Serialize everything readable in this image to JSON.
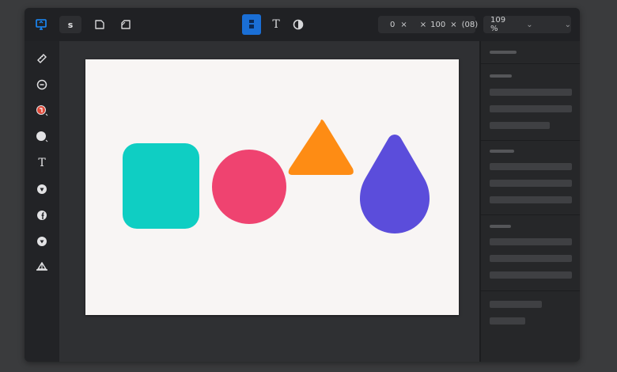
{
  "toolbar": {
    "icons": [
      "monitor-icon",
      "s-icon",
      "square-icon",
      "crop-icon",
      "document-icon",
      "text-icon",
      "fill-icon"
    ],
    "text_tool_glyph": "T",
    "s_glyph": "s",
    "position": {
      "x": "0",
      "x_sep": "×",
      "w": "100",
      "w_sep": "×",
      "extra": "(08)"
    },
    "zoom": {
      "value": "109 %",
      "chevron": "⌄"
    },
    "menu_chevron": "⌄"
  },
  "sidebar": {
    "tools": [
      {
        "name": "ruler-icon"
      },
      {
        "name": "minus-circle-icon"
      },
      {
        "name": "color-circle-icon"
      },
      {
        "name": "circle-tool-icon"
      },
      {
        "name": "text-tool-icon",
        "glyph": "T"
      },
      {
        "name": "shield-icon"
      },
      {
        "name": "facebook-icon",
        "glyph": "f"
      },
      {
        "name": "heart-shield-icon"
      },
      {
        "name": "boat-icon"
      }
    ]
  },
  "canvas": {
    "shapes": [
      {
        "name": "teal-rounded-square",
        "color": "#0fcec3"
      },
      {
        "name": "pink-circle",
        "color": "#ef4370"
      },
      {
        "name": "orange-triangle",
        "color": "#fe8c14"
      },
      {
        "name": "purple-drop",
        "color": "#5b4ddb"
      }
    ],
    "background": "#f8f5f4"
  },
  "colors": {
    "accent": "#1a6fd6",
    "topbar": "#202124",
    "panel": "#262729"
  }
}
